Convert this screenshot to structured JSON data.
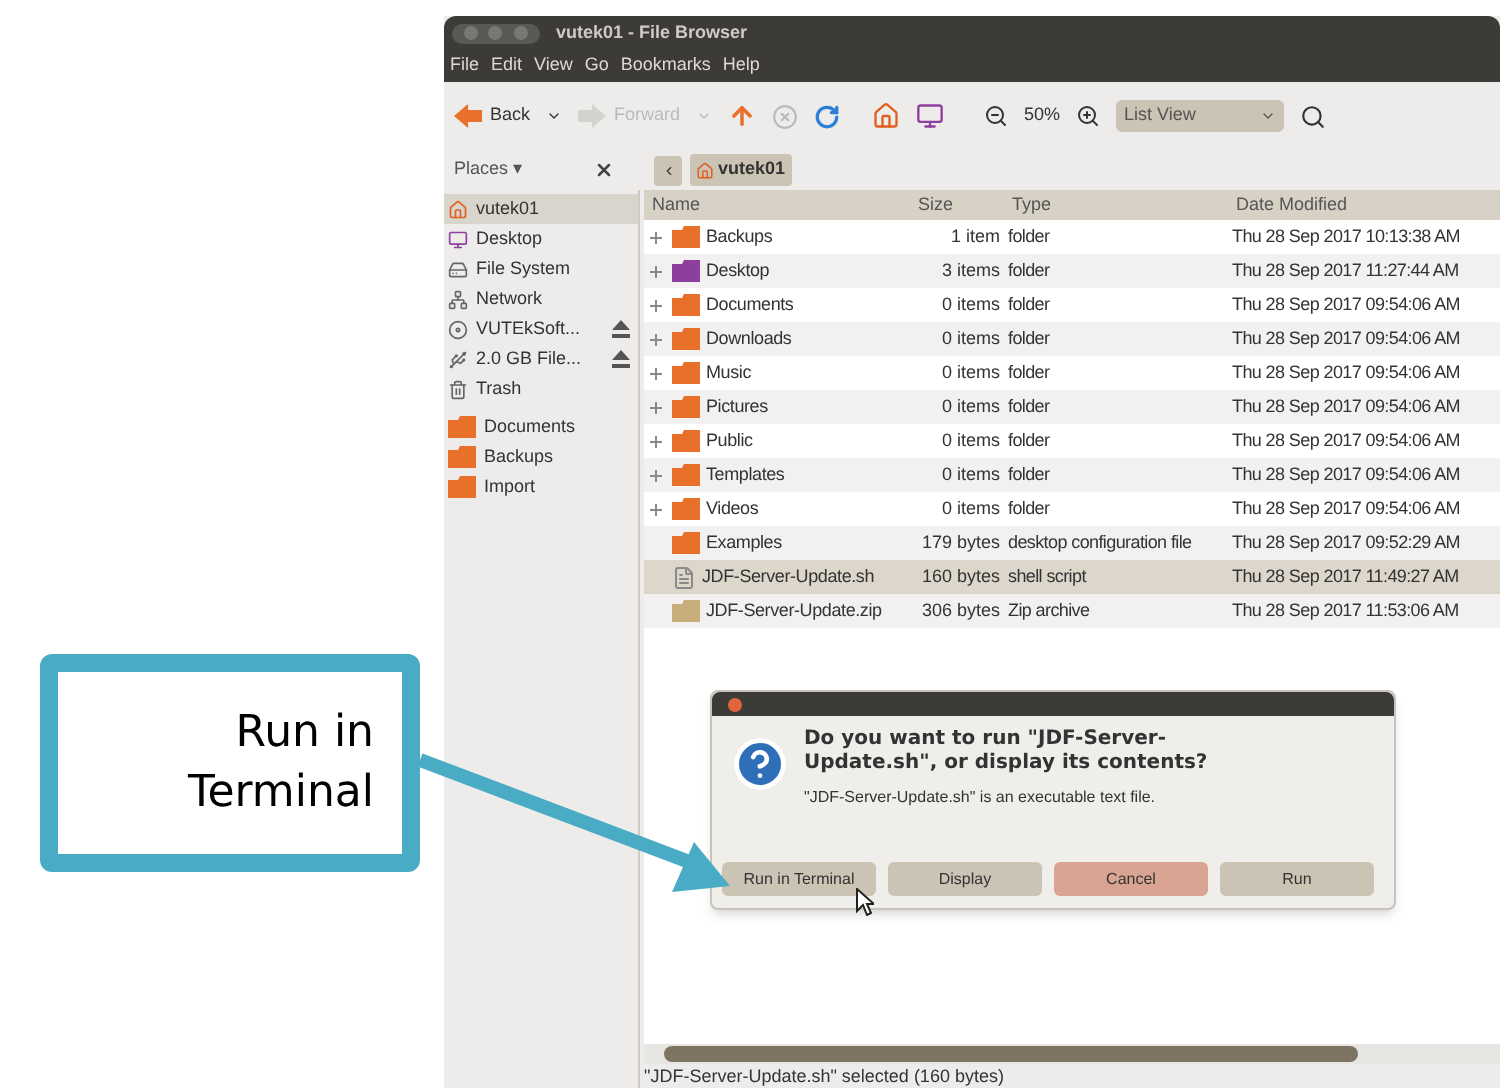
{
  "window": {
    "title": "vutek01 - File Browser"
  },
  "menu": [
    "File",
    "Edit",
    "View",
    "Go",
    "Bookmarks",
    "Help"
  ],
  "toolbar": {
    "back": {
      "label": "Back",
      "disabled": false
    },
    "forward": {
      "label": "Forward",
      "disabled": true
    },
    "zoom": "50%",
    "view": "List View"
  },
  "location": {
    "places": "Places ▾",
    "path": [
      {
        "label": "vutek01",
        "selected": true
      }
    ]
  },
  "sidebar": {
    "devices": [
      {
        "label": "vutek01",
        "kind": "home",
        "selected": true,
        "ejectable": false
      },
      {
        "label": "Desktop",
        "kind": "desktop",
        "selected": false,
        "ejectable": false
      },
      {
        "label": "File System",
        "kind": "drive",
        "selected": false,
        "ejectable": false
      },
      {
        "label": "Network",
        "kind": "network",
        "selected": false,
        "ejectable": false
      },
      {
        "label": "VUTEkSoft...",
        "kind": "disc",
        "selected": false,
        "ejectable": true
      },
      {
        "label": "2.0 GB File...",
        "kind": "usb",
        "selected": false,
        "ejectable": true
      },
      {
        "label": "Trash",
        "kind": "trash",
        "selected": false,
        "ejectable": false
      }
    ],
    "bookmarks": [
      {
        "label": "Documents",
        "kind": "folder",
        "selected": false,
        "ejectable": false
      },
      {
        "label": "Backups",
        "kind": "folder",
        "selected": false,
        "ejectable": false
      },
      {
        "label": "Import",
        "kind": "folder",
        "selected": false,
        "ejectable": false
      }
    ]
  },
  "table": {
    "columns": [
      "Name",
      "Size",
      "Type",
      "Date Modified"
    ],
    "rows": [
      {
        "name": "Backups",
        "size": "1 item",
        "type": "folder",
        "date": "Thu 28 Sep 2017 10:13:38 AM",
        "kind": "folder",
        "expandable": true,
        "selected": false
      },
      {
        "name": "Desktop",
        "size": "3 items",
        "type": "folder",
        "date": "Thu 28 Sep 2017 11:27:44 AM",
        "kind": "desktop",
        "expandable": true,
        "selected": false
      },
      {
        "name": "Documents",
        "size": "0 items",
        "type": "folder",
        "date": "Thu 28 Sep 2017 09:54:06 AM",
        "kind": "folder",
        "expandable": true,
        "selected": false
      },
      {
        "name": "Downloads",
        "size": "0 items",
        "type": "folder",
        "date": "Thu 28 Sep 2017 09:54:06 AM",
        "kind": "folder",
        "expandable": true,
        "selected": false
      },
      {
        "name": "Music",
        "size": "0 items",
        "type": "folder",
        "date": "Thu 28 Sep 2017 09:54:06 AM",
        "kind": "folder",
        "expandable": true,
        "selected": false
      },
      {
        "name": "Pictures",
        "size": "0 items",
        "type": "folder",
        "date": "Thu 28 Sep 2017 09:54:06 AM",
        "kind": "folder",
        "expandable": true,
        "selected": false
      },
      {
        "name": "Public",
        "size": "0 items",
        "type": "folder",
        "date": "Thu 28 Sep 2017 09:54:06 AM",
        "kind": "folder",
        "expandable": true,
        "selected": false
      },
      {
        "name": "Templates",
        "size": "0 items",
        "type": "folder",
        "date": "Thu 28 Sep 2017 09:54:06 AM",
        "kind": "folder",
        "expandable": true,
        "selected": false
      },
      {
        "name": "Videos",
        "size": "0 items",
        "type": "folder",
        "date": "Thu 28 Sep 2017 09:54:06 AM",
        "kind": "folder",
        "expandable": true,
        "selected": false
      },
      {
        "name": "Examples",
        "size": "179 bytes",
        "type": "desktop configuration file",
        "date": "Thu 28 Sep 2017 09:52:29 AM",
        "kind": "folder",
        "expandable": false,
        "selected": false
      },
      {
        "name": "JDF-Server-Update.sh",
        "size": "160 bytes",
        "type": "shell script",
        "date": "Thu 28 Sep 2017 11:49:27 AM",
        "kind": "script",
        "expandable": false,
        "selected": true
      },
      {
        "name": "JDF-Server-Update.zip",
        "size": "306 bytes",
        "type": "Zip archive",
        "date": "Thu 28 Sep 2017 11:53:06 AM",
        "kind": "archive",
        "expandable": false,
        "selected": false
      }
    ]
  },
  "dialog": {
    "heading": "Do you want to run \"JDF-Server-Update.sh\", or display its contents?",
    "message": "\"JDF-Server-Update.sh\" is an executable text file.",
    "buttons": [
      {
        "label": "Run in Terminal",
        "kind": "default"
      },
      {
        "label": "Display",
        "kind": "default"
      },
      {
        "label": "Cancel",
        "kind": "cancel"
      },
      {
        "label": "Run",
        "kind": "default"
      }
    ]
  },
  "status_bar": "\"JDF-Server-Update.sh\" selected (160 bytes)",
  "callout": {
    "text": "Run in Terminal"
  }
}
